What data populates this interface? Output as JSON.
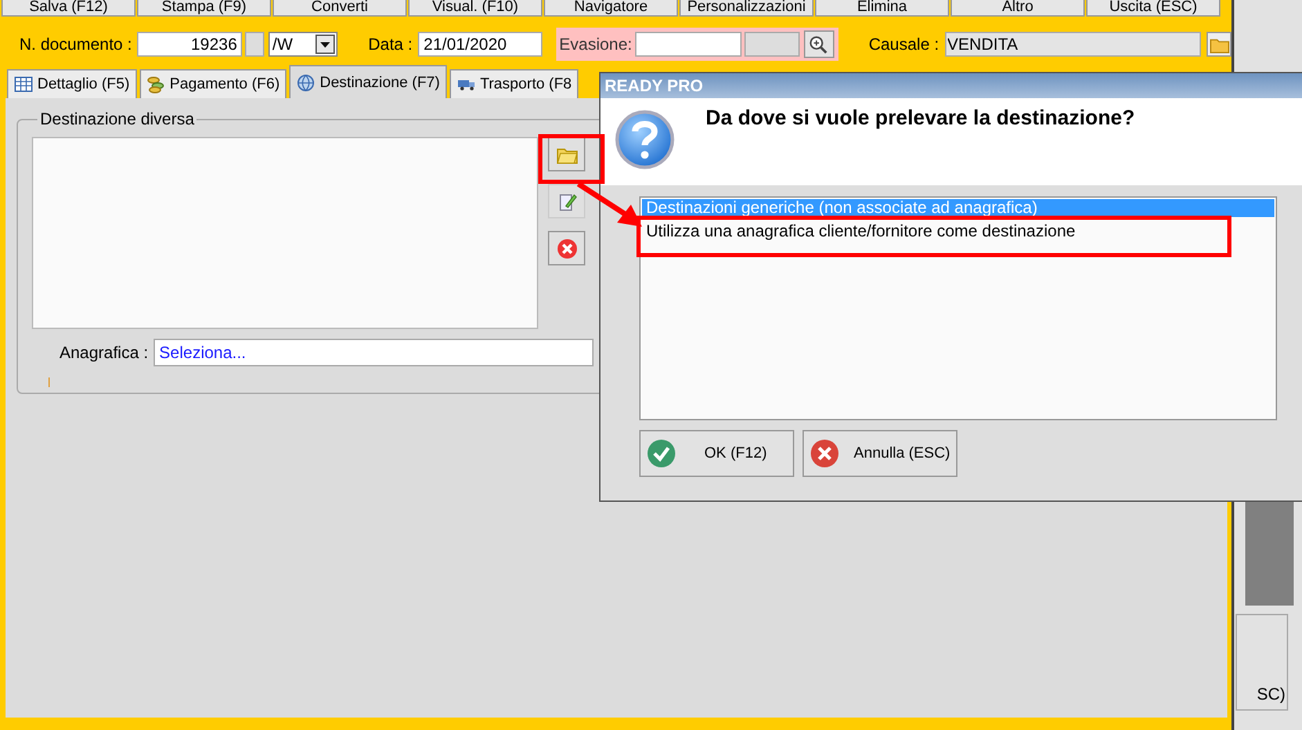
{
  "toolbar": {
    "buttons": [
      "Salva (F12)",
      "Stampa (F9)",
      "Converti",
      "Visual. (F10)",
      "Navigatore",
      "Personalizzazioni",
      "Elimina",
      "Altro",
      "Uscita (ESC)"
    ]
  },
  "header": {
    "document_number_label": "N. documento :",
    "document_number": "19236",
    "series": "/W",
    "date_label": "Data :",
    "date": "21/01/2020",
    "evasione_label": "Evasione:",
    "causale_label": "Causale :",
    "causale": "VENDITA"
  },
  "tabs": [
    {
      "label": "Dettaglio (F5)",
      "kind": "table",
      "selected": false
    },
    {
      "label": "Pagamento (F6)",
      "kind": "coins",
      "selected": false
    },
    {
      "label": "Destinazione (F7)",
      "kind": "globe",
      "selected": true
    },
    {
      "label": "Trasporto (F8",
      "kind": "truck",
      "selected": false
    }
  ],
  "destination_group": {
    "title": "Destinazione diversa",
    "anagrafica_label": "Anagrafica :",
    "anagrafica_value": "Seleziona..."
  },
  "background_window": {
    "button_text": "SC)"
  },
  "dialog": {
    "title": "READY PRO",
    "question": "Da dove si vuole prelevare la destinazione?",
    "options": [
      {
        "label": "Destinazioni generiche (non associate ad anagrafica)",
        "selected": true
      },
      {
        "label": "Utilizza una anagrafica cliente/fornitore come destinazione",
        "selected": false
      }
    ],
    "buttons": [
      {
        "label": "OK (F12)",
        "kind": "ok"
      },
      {
        "label": "Annulla (ESC)",
        "kind": "cancel"
      }
    ]
  }
}
